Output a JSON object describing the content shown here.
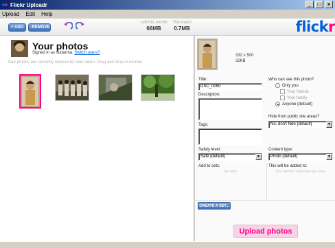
{
  "window": {
    "title": "Flickr Uploadr",
    "controls": [
      "_",
      "□",
      "×"
    ]
  },
  "menu": [
    "Upload",
    "Edit",
    "Help"
  ],
  "toolbar": {
    "add_label": "+ ADD",
    "remove_label": "- REMOVE",
    "left_month_label": "Left this month",
    "left_month_value": "66MB",
    "this_batch_label": "This batch",
    "this_batch_value": "0.7MB",
    "logo_flick": "flick",
    "logo_r": "r"
  },
  "main": {
    "title": "Your photos",
    "signed_in_prefix": "Signed in as sudarma.",
    "switch_users": "Switch users?",
    "info": "Your photos are currently ordered by date taken. Drag and drop to reorder."
  },
  "details": {
    "dimensions": "332 x 500",
    "size": "32KB",
    "title_label": "Title:",
    "title_value": "DSC_0050",
    "description_label": "Description:",
    "description_value": "",
    "tags_label": "Tags:",
    "tags_value": "",
    "privacy_label": "Who can see this photo?",
    "privacy_options": [
      "Only you",
      "Your friends",
      "Your family",
      "Anyone (default)"
    ],
    "hide_label": "Hide from public site areas?",
    "hide_value": "No, don't hide (default)",
    "safety_label": "Safety level:",
    "safety_value": "Safe (default)",
    "content_label": "Content type:",
    "content_value": "Photo (default)",
    "add_sets_label": "Add to sets:",
    "add_sets_note": "No sets",
    "will_add_label": "This will be added to:",
    "will_add_note": "You haven't selected any sets.",
    "create_set": "CREATE A SET...",
    "upload": "Upload photos"
  },
  "colors": {
    "flickr_blue": "#0063dc",
    "flickr_pink": "#ff0084"
  }
}
